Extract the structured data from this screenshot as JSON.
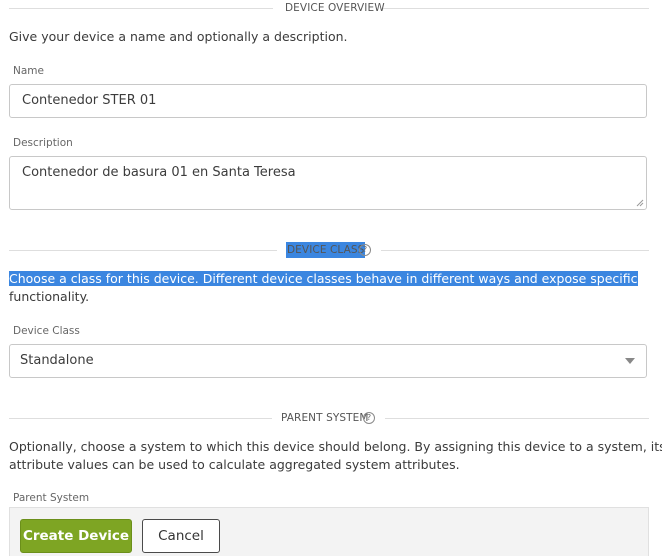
{
  "device_overview": {
    "title": "DEVICE OVERVIEW",
    "intro": "Give your device a name and optionally a description.",
    "name_label": "Name",
    "name_value": "Contenedor STER 01",
    "description_label": "Description",
    "description_value": "Contenedor de basura 01 en Santa Teresa"
  },
  "device_class": {
    "title": "DEVICE CLASS",
    "help_icon": "question-circle-icon",
    "intro_line1": "Choose a class for this device. Different device classes behave in different ways and expose specific",
    "intro_line2": "functionality.",
    "field_label": "Device Class",
    "selected": "Standalone",
    "selection_color": "#3b86e0"
  },
  "parent_system": {
    "title": "PARENT SYSTEM",
    "help_icon": "question-circle-icon",
    "intro_line1": "Optionally, choose a system to which this device should belong. By assigning this device to a system, its raw",
    "intro_line2": "attribute values can be used to calculate aggregated system attributes.",
    "field_label": "Parent System"
  },
  "actions": {
    "create_label": "Create Device",
    "cancel_label": "Cancel",
    "primary_color": "#7ea523"
  }
}
